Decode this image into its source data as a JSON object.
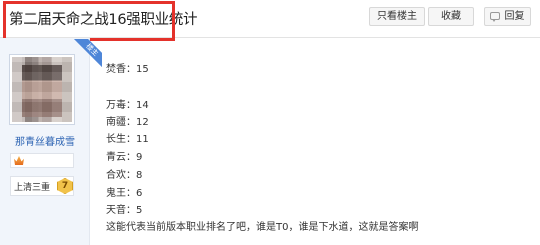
{
  "header": {
    "title": "第二届天命之战16强职业统计",
    "buttons": {
      "only_author": "只看楼主",
      "favorite": "收藏",
      "reply": "回复"
    }
  },
  "user": {
    "corner_badge": "楼主",
    "name": "那青丝暮成雪",
    "level_name": "上清三重",
    "level_number": "7"
  },
  "post": {
    "lines": [
      "焚香：15",
      "万毒：14",
      "南疆：12",
      "长生：11",
      "青云：9",
      "合欢：8",
      "鬼王：6",
      "天音：5",
      "这能代表当前版本职业排名了吧，谁是T0，谁是下水道，这就是答案啊"
    ]
  },
  "colors": {
    "highlight_border": "#e4322b",
    "username": "#2d64b3",
    "badge": "#4e86d8"
  }
}
